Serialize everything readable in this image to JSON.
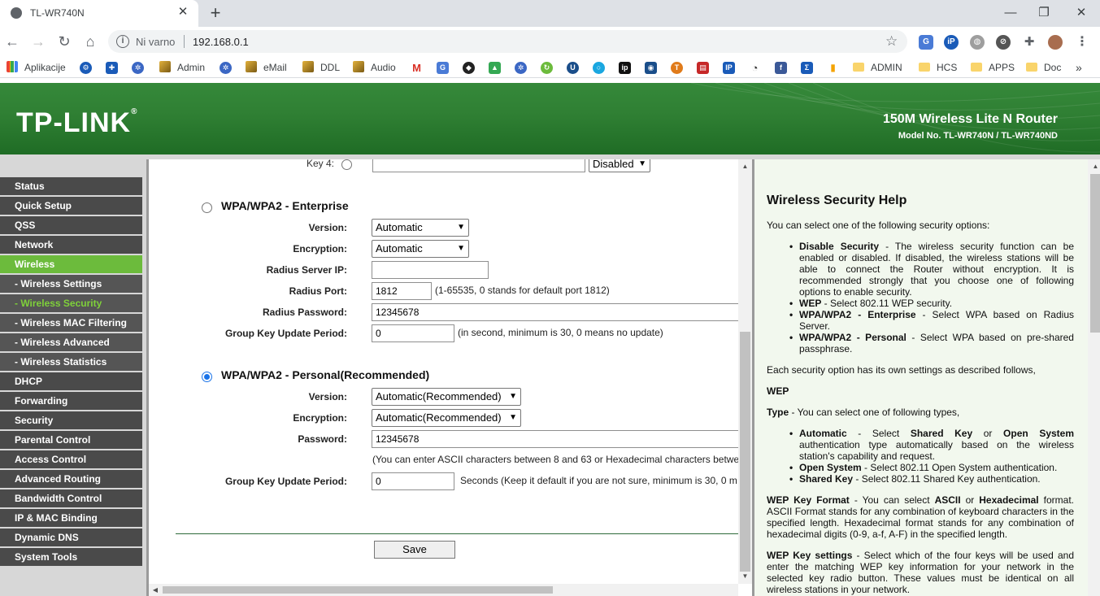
{
  "browser": {
    "tab_title": "TL-WR740N",
    "not_secure": "Ni varno",
    "url": "192.168.0.1"
  },
  "bookmarks": {
    "apps": "Aplikacije",
    "admin": "Admin",
    "email": "eMail",
    "ddl": "DDL",
    "audio": "Audio",
    "admin_folder": "ADMIN",
    "hcs": "HCS",
    "apps_folder": "APPS",
    "doc": "Doc"
  },
  "banner": {
    "logo": "TP-LINK",
    "product": "150M Wireless Lite N Router",
    "model": "Model No. TL-WR740N / TL-WR740ND"
  },
  "nav": {
    "status": "Status",
    "quick_setup": "Quick Setup",
    "qss": "QSS",
    "network": "Network",
    "wireless": "Wireless",
    "wireless_settings": "- Wireless Settings",
    "wireless_security": "- Wireless Security",
    "wireless_mac": "- Wireless MAC Filtering",
    "wireless_advanced": "- Wireless Advanced",
    "wireless_statistics": "- Wireless Statistics",
    "dhcp": "DHCP",
    "forwarding": "Forwarding",
    "security": "Security",
    "parental": "Parental Control",
    "access": "Access Control",
    "routing": "Advanced Routing",
    "bandwidth": "Bandwidth Control",
    "ipmac": "IP & MAC Binding",
    "ddns": "Dynamic DNS",
    "system": "System Tools"
  },
  "form": {
    "key4_label": "Key 4:",
    "key4_type": "Disabled",
    "enterprise": {
      "title": "WPA/WPA2 - Enterprise",
      "version_label": "Version:",
      "version_value": "Automatic",
      "encryption_label": "Encryption:",
      "encryption_value": "Automatic",
      "radius_ip_label": "Radius Server IP:",
      "radius_ip_value": "",
      "radius_port_label": "Radius Port:",
      "radius_port_value": "1812",
      "radius_port_hint": "(1-65535, 0 stands for default port 1812)",
      "radius_password_label": "Radius Password:",
      "radius_password_value": "12345678",
      "gkup_label": "Group Key Update Period:",
      "gkup_value": "0",
      "gkup_hint": "(in second, minimum is 30, 0 means no update)"
    },
    "personal": {
      "title": "WPA/WPA2 - Personal(Recommended)",
      "version_label": "Version:",
      "version_value": "Automatic(Recommended)",
      "encryption_label": "Encryption:",
      "encryption_value": "Automatic(Recommended)",
      "password_label": "Password:",
      "password_value": "12345678",
      "password_hint": "(You can enter ASCII characters between 8 and 63 or Hexadecimal characters betwe",
      "gkup_label": "Group Key Update Period:",
      "gkup_value": "0",
      "gkup_hint": "Seconds (Keep it default if you are not sure, minimum is 30, 0 m"
    },
    "save": "Save"
  },
  "help": {
    "title": "Wireless Security Help",
    "intro": "You can select one of the following security options:",
    "opt1_bold": "Disable Security",
    "opt1_text": " - The wireless security function can be enabled or disabled. If disabled, the wireless stations will be able to connect the Router without encryption. It is recommended strongly that you choose one of following options to enable security.",
    "opt2_bold": "WEP",
    "opt2_text": " - Select 802.11 WEP security.",
    "opt3_bold": "WPA/WPA2 - Enterprise",
    "opt3_text": " - Select WPA based on Radius Server.",
    "opt4_bold": "WPA/WPA2 - Personal",
    "opt4_text": " - Select WPA based on pre-shared passphrase.",
    "each": "Each security option has its own settings as described follows,",
    "wep_heading": "WEP",
    "type_bold": "Type",
    "type_text": " - You can select one of following types,",
    "t1_bold": "Automatic",
    "t1_text1": " - Select ",
    "t1_bold2": "Shared Key",
    "t1_text2": " or ",
    "t1_bold3": "Open System",
    "t1_text3": " authentication type automatically based on the wireless station's capability and request.",
    "t2_bold": "Open System",
    "t2_text": " - Select 802.11 Open System authentication.",
    "t3_bold": "Shared Key",
    "t3_text": " - Select 802.11 Shared Key authentication.",
    "fmt_bold": "WEP Key Format",
    "fmt_text1": " - You can select ",
    "fmt_bold2": "ASCII",
    "fmt_text2": " or ",
    "fmt_bold3": "Hexadecimal",
    "fmt_text3": " format. ASCII Format stands for any combination of keyboard characters in the specified length. Hexadecimal format stands for any combination of hexadecimal digits (0-9, a-f, A-F) in the specified length.",
    "keys_bold": "WEP Key settings",
    "keys_text": " - Select which of the four keys will be used and enter the matching WEP key information for your network in the selected key radio button. These values must be identical on all wireless stations in your network."
  }
}
